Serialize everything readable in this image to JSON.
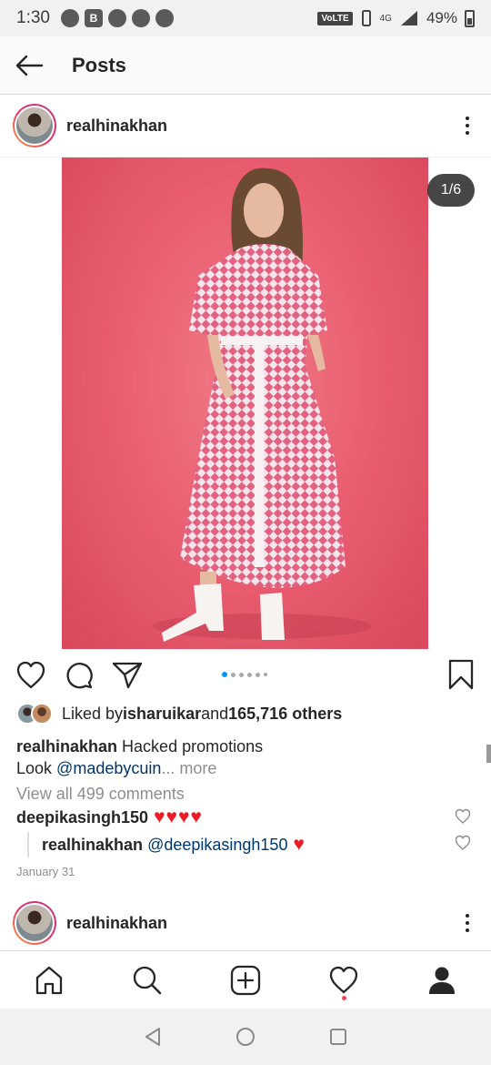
{
  "status_bar": {
    "time": "1:30",
    "network": "4G",
    "volte": "VoLTE",
    "battery": "49%"
  },
  "app_bar": {
    "title": "Posts"
  },
  "post": {
    "username": "realhinakhan",
    "carousel_counter": "1/6",
    "carousel_position": 1,
    "carousel_total": 6,
    "liked_by_prefix": "Liked by ",
    "liked_by_user": "isharuikar",
    "liked_by_and": " and ",
    "liked_by_others": "165,716 others",
    "caption_user": "realhinakhan",
    "caption_text": " Hacked promotions",
    "caption_line2_prefix": "Look ",
    "caption_mention": "@madebycuin",
    "caption_more": "... more",
    "view_comments": "View all 499 comments",
    "comments": [
      {
        "user": "deepikasingh150",
        "text": "♥♥♥♥"
      },
      {
        "user": "realhinakhan",
        "mention": "@deepikasingh150",
        "text": "♥"
      }
    ],
    "date": "January 31"
  },
  "next_post": {
    "username": "realhinakhan"
  },
  "colors": {
    "accent": "#0095f6",
    "like_red": "#ed1c24",
    "photo_bg": "#e85b6e",
    "mention": "#00376b"
  },
  "icons": {
    "back": "arrow-left-icon",
    "like": "heart-icon",
    "comment": "comment-icon",
    "share": "paper-plane-icon",
    "save": "bookmark-icon",
    "home": "home-icon",
    "search": "search-icon",
    "add": "add-post-icon",
    "activity": "heart-icon",
    "profile": "profile-icon"
  }
}
